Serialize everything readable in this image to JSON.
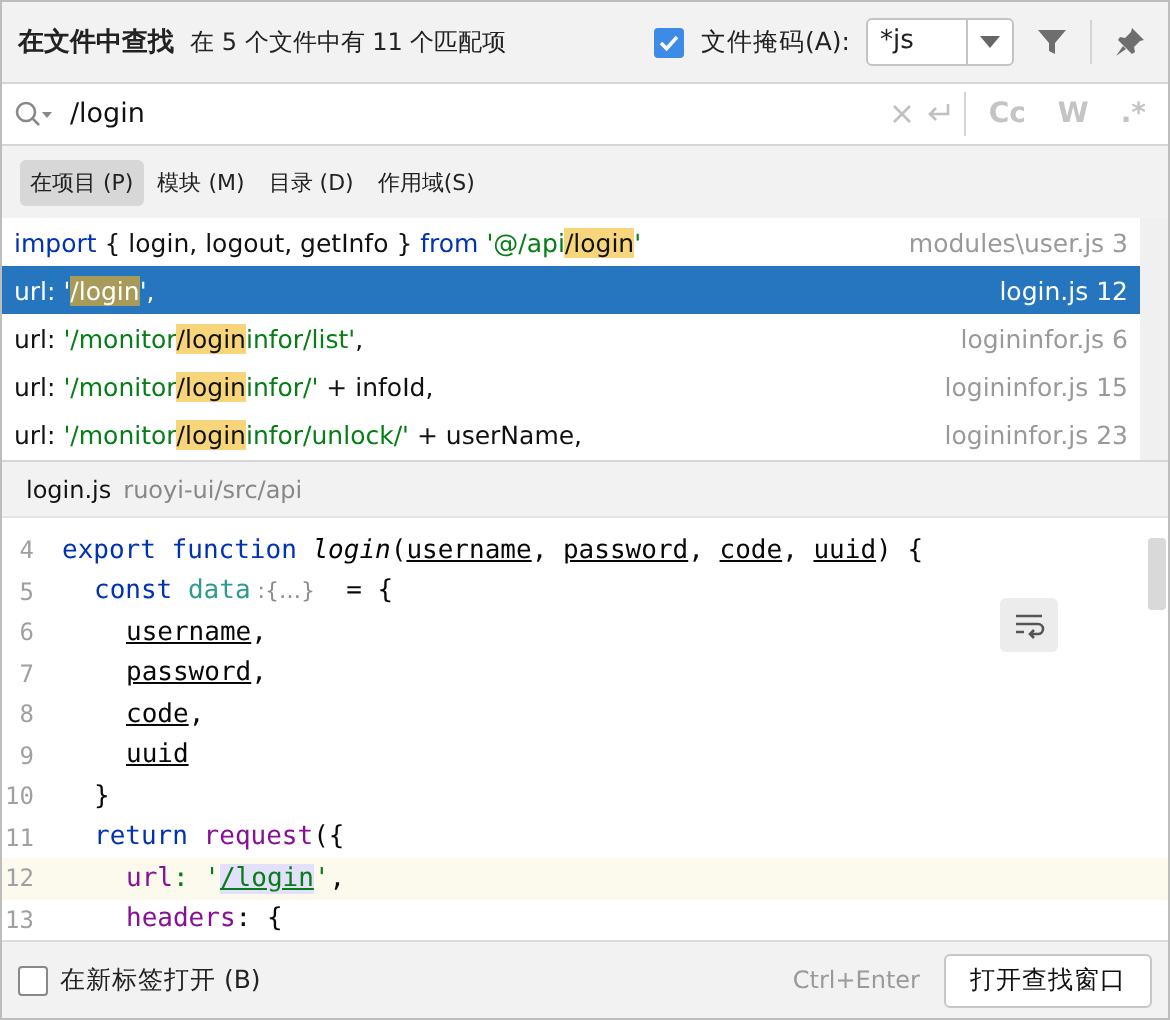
{
  "header": {
    "title": "在文件中查找",
    "summary": "在 5 个文件中有 11 个匹配项",
    "file_mask": {
      "label": "文件掩码(A):",
      "checked": true,
      "value": "*js"
    }
  },
  "search": {
    "value": "/login"
  },
  "options": [
    {
      "label": "Cc",
      "on": false
    },
    {
      "label": "W",
      "on": false
    },
    {
      "label": ".*",
      "on": false
    }
  ],
  "scopes": [
    {
      "label": "在项目 (P)",
      "selected": true
    },
    {
      "label": "模块 (M)",
      "selected": false
    },
    {
      "label": "目录 (D)",
      "selected": false
    },
    {
      "label": "作用域(S)",
      "selected": false
    }
  ],
  "results": [
    {
      "selected": false,
      "file": "modules\\user.js 3",
      "segments": [
        {
          "text": "import",
          "kind": "keyword"
        },
        {
          "text": " { login, logout, getInfo } ",
          "kind": "plain"
        },
        {
          "text": "from",
          "kind": "keyword"
        },
        {
          "text": " '@/api",
          "kind": "string"
        },
        {
          "text": "/login",
          "kind": "match"
        },
        {
          "text": "'",
          "kind": "string"
        }
      ]
    },
    {
      "selected": true,
      "file": "login.js 12",
      "segments": [
        {
          "text": "url: '",
          "kind": "plain"
        },
        {
          "text": "/login",
          "kind": "match"
        },
        {
          "text": "',",
          "kind": "plain"
        }
      ]
    },
    {
      "selected": false,
      "file": "logininfor.js 6",
      "segments": [
        {
          "text": "url: ",
          "kind": "plain"
        },
        {
          "text": "'/monitor",
          "kind": "string"
        },
        {
          "text": "/login",
          "kind": "match"
        },
        {
          "text": "infor/list'",
          "kind": "string"
        },
        {
          "text": ",",
          "kind": "plain"
        }
      ]
    },
    {
      "selected": false,
      "file": "logininfor.js 15",
      "segments": [
        {
          "text": "url: ",
          "kind": "plain"
        },
        {
          "text": "'/monitor",
          "kind": "string"
        },
        {
          "text": "/login",
          "kind": "match"
        },
        {
          "text": "infor/'",
          "kind": "string"
        },
        {
          "text": " + infoId,",
          "kind": "plain"
        }
      ]
    },
    {
      "selected": false,
      "file": "logininfor.js 23",
      "segments": [
        {
          "text": "url: ",
          "kind": "plain"
        },
        {
          "text": "'/monitor",
          "kind": "string"
        },
        {
          "text": "/login",
          "kind": "match"
        },
        {
          "text": "infor/unlock/'",
          "kind": "string"
        },
        {
          "text": " + userName,",
          "kind": "plain"
        }
      ]
    }
  ],
  "preview": {
    "file": "login.js",
    "path": "ruoyi-ui/src/api"
  },
  "code": [
    {
      "number": "4",
      "current": false,
      "tokens": [
        {
          "text": "export function ",
          "kind": "keyword"
        },
        {
          "text": "login",
          "kind": "function"
        },
        {
          "text": "(",
          "kind": "plain"
        },
        {
          "text": "username",
          "kind": "param"
        },
        {
          "text": ", ",
          "kind": "plain"
        },
        {
          "text": "password",
          "kind": "param"
        },
        {
          "text": ", ",
          "kind": "plain"
        },
        {
          "text": "code",
          "kind": "param"
        },
        {
          "text": ", ",
          "kind": "plain"
        },
        {
          "text": "uuid",
          "kind": "param"
        },
        {
          "text": ") {",
          "kind": "plain"
        }
      ],
      "children": [
        {
          "number": "5",
          "current": false,
          "tokens": [
            {
              "text": "const ",
              "kind": "keyword"
            },
            {
              "text": "data",
              "kind": "member"
            },
            {
              "text": " :{…}",
              "kind": "hint"
            },
            {
              "text": "  = {",
              "kind": "plain"
            }
          ],
          "children": [
            {
              "number": "6",
              "current": false,
              "tokens": [
                {
                  "text": "username",
                  "kind": "param"
                },
                {
                  "text": ",",
                  "kind": "plain"
                }
              ]
            },
            {
              "number": "7",
              "current": false,
              "tokens": [
                {
                  "text": "password",
                  "kind": "param"
                },
                {
                  "text": ",",
                  "kind": "plain"
                }
              ]
            },
            {
              "number": "8",
              "current": false,
              "tokens": [
                {
                  "text": "code",
                  "kind": "param"
                },
                {
                  "text": ",",
                  "kind": "plain"
                }
              ]
            },
            {
              "number": "9",
              "current": false,
              "tokens": [
                {
                  "text": "uuid",
                  "kind": "param"
                }
              ]
            }
          ]
        },
        {
          "number": "10",
          "current": false,
          "tokens": [
            {
              "text": "}",
              "kind": "plain"
            }
          ]
        },
        {
          "number": "11",
          "current": false,
          "tokens": [
            {
              "text": "return ",
              "kind": "keyword"
            },
            {
              "text": "request",
              "kind": "property"
            },
            {
              "text": "({",
              "kind": "plain"
            }
          ],
          "children": [
            {
              "number": "12",
              "current": true,
              "tokens": [
                {
                  "text": "url",
                  "kind": "property"
                },
                {
                  "text": ": '",
                  "kind": "string"
                },
                {
                  "text": "/login",
                  "kind": "match"
                },
                {
                  "text": "'",
                  "kind": "string"
                },
                {
                  "text": ",",
                  "kind": "plain"
                }
              ]
            },
            {
              "number": "13",
              "current": false,
              "tokens": [
                {
                  "text": "headers",
                  "kind": "property"
                },
                {
                  "text": ": {",
                  "kind": "plain"
                }
              ]
            }
          ]
        }
      ]
    }
  ],
  "footer": {
    "new_tab": {
      "label": "在新标签打开 (B)",
      "checked": false
    },
    "shortcut": "Ctrl+Enter",
    "button": "打开查找窗口"
  }
}
